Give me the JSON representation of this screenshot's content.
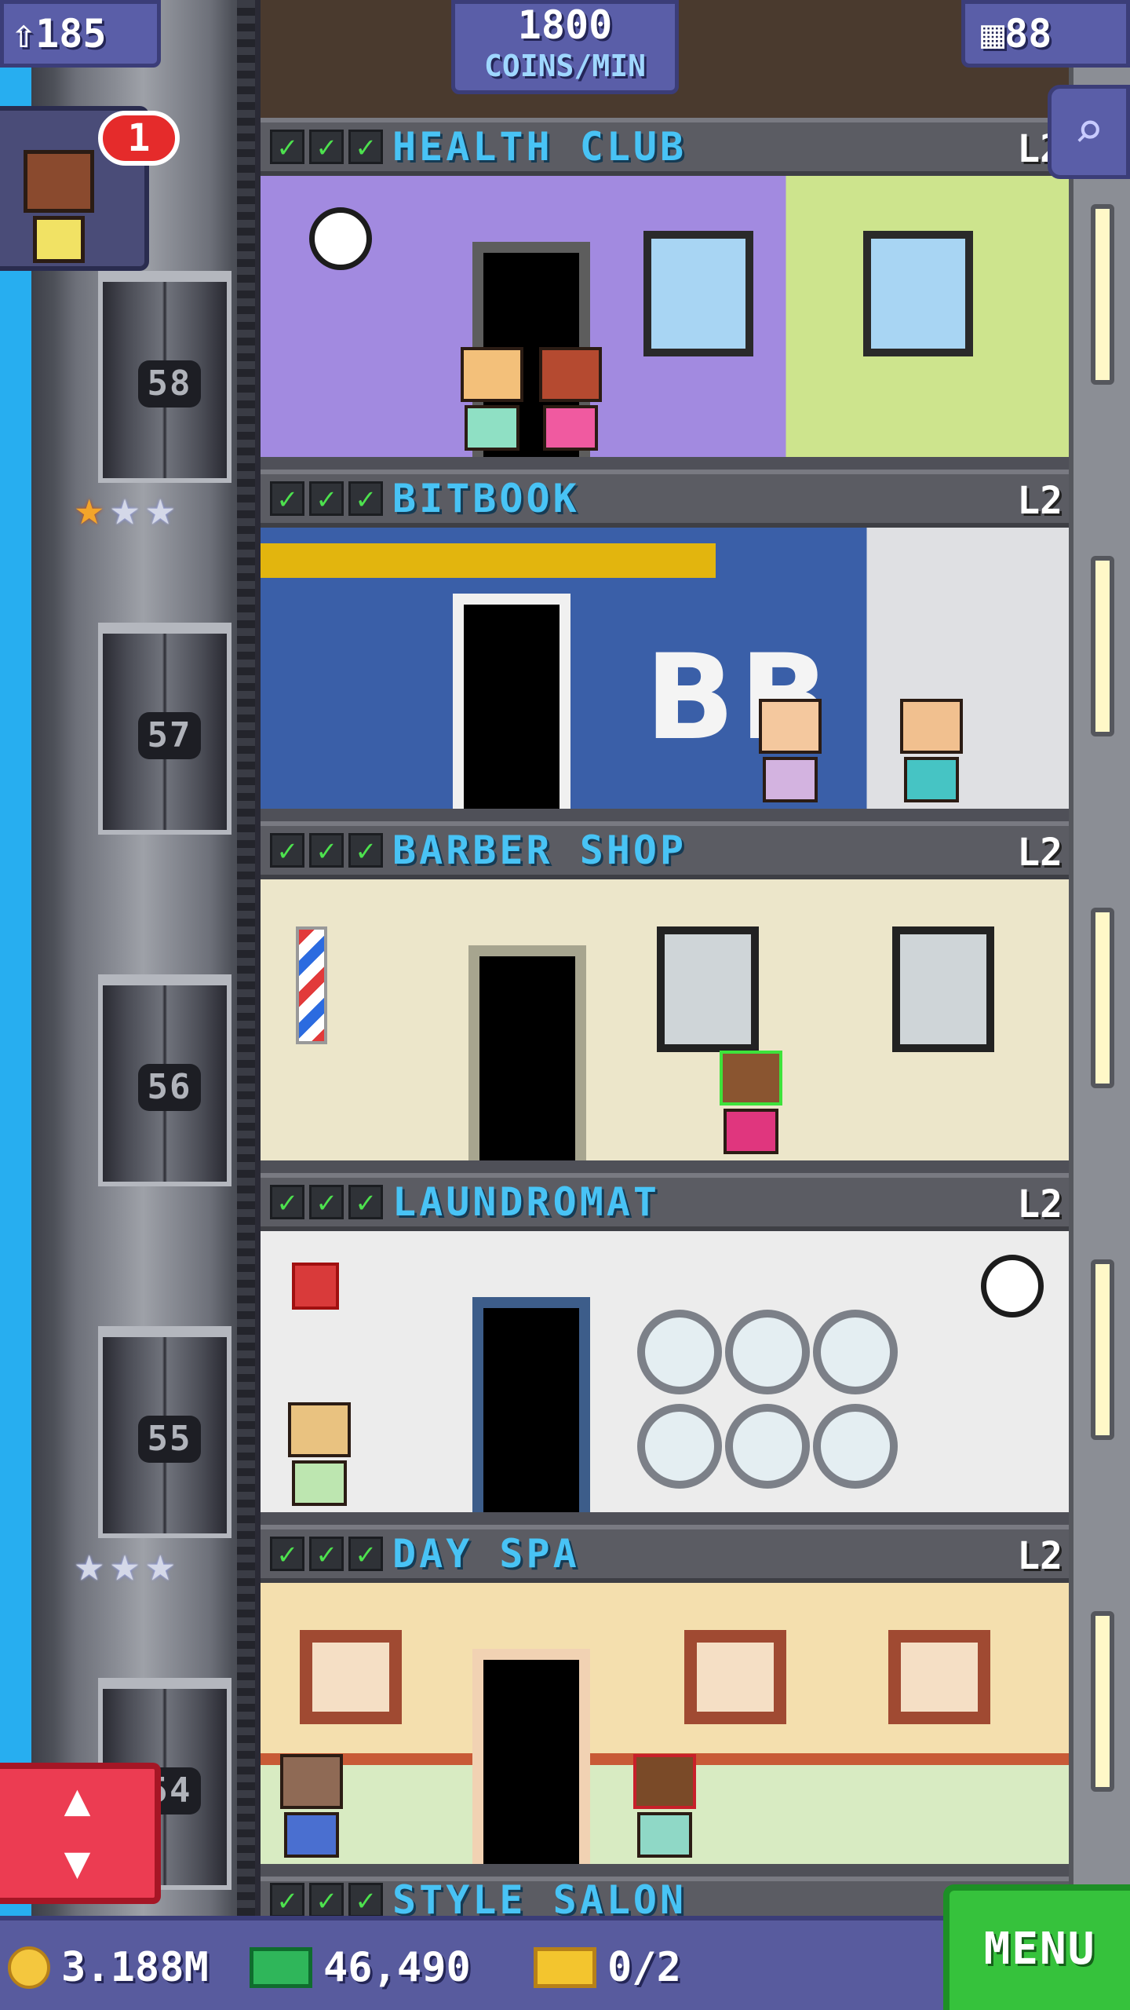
{
  "hud": {
    "population": "185",
    "coins_per_min_value": "1800",
    "coins_per_min_label": "COINS/MIN",
    "floor_count": "88"
  },
  "notification": {
    "count": "1"
  },
  "elevator": {
    "floor_numbers": [
      "58",
      "57",
      "56",
      "55",
      "54"
    ]
  },
  "floors": [
    {
      "name": "HEALTH CLUB",
      "level": "L2",
      "checks": 3
    },
    {
      "name": "BITBOOK",
      "level": "L2",
      "checks": 3,
      "sign": "BB"
    },
    {
      "name": "BARBER SHOP",
      "level": "L2",
      "checks": 3
    },
    {
      "name": "LAUNDROMAT",
      "level": "L2",
      "checks": 3
    },
    {
      "name": "DAY SPA",
      "level": "L2",
      "checks": 3
    },
    {
      "name": "STYLE SALON",
      "level": "",
      "checks": 3
    }
  ],
  "star_rows": [
    {
      "gold": 1,
      "silver": 2
    },
    {
      "gold": 0,
      "silver": 3
    }
  ],
  "bottom_bar": {
    "coins": "3.188M",
    "bux": "46,490",
    "tickets": "0/2",
    "menu_label": "MENU"
  },
  "icons": {
    "population": "person-up-icon",
    "floors": "building-icon",
    "search": "magnifier-icon",
    "elevator": "up-down-arrows-icon",
    "check": "check-icon",
    "star": "star-icon",
    "coin": "coin-icon",
    "bux": "bux-icon",
    "ticket": "ticket-icon"
  },
  "colors": {
    "sky": "#27aef0",
    "hud_bg": "#5a5ea8",
    "floor_name": "#48c3f5",
    "check": "#4de14e",
    "menu": "#36c23c",
    "elevator_button": "#ec3c52",
    "badge": "#e52b2b"
  }
}
